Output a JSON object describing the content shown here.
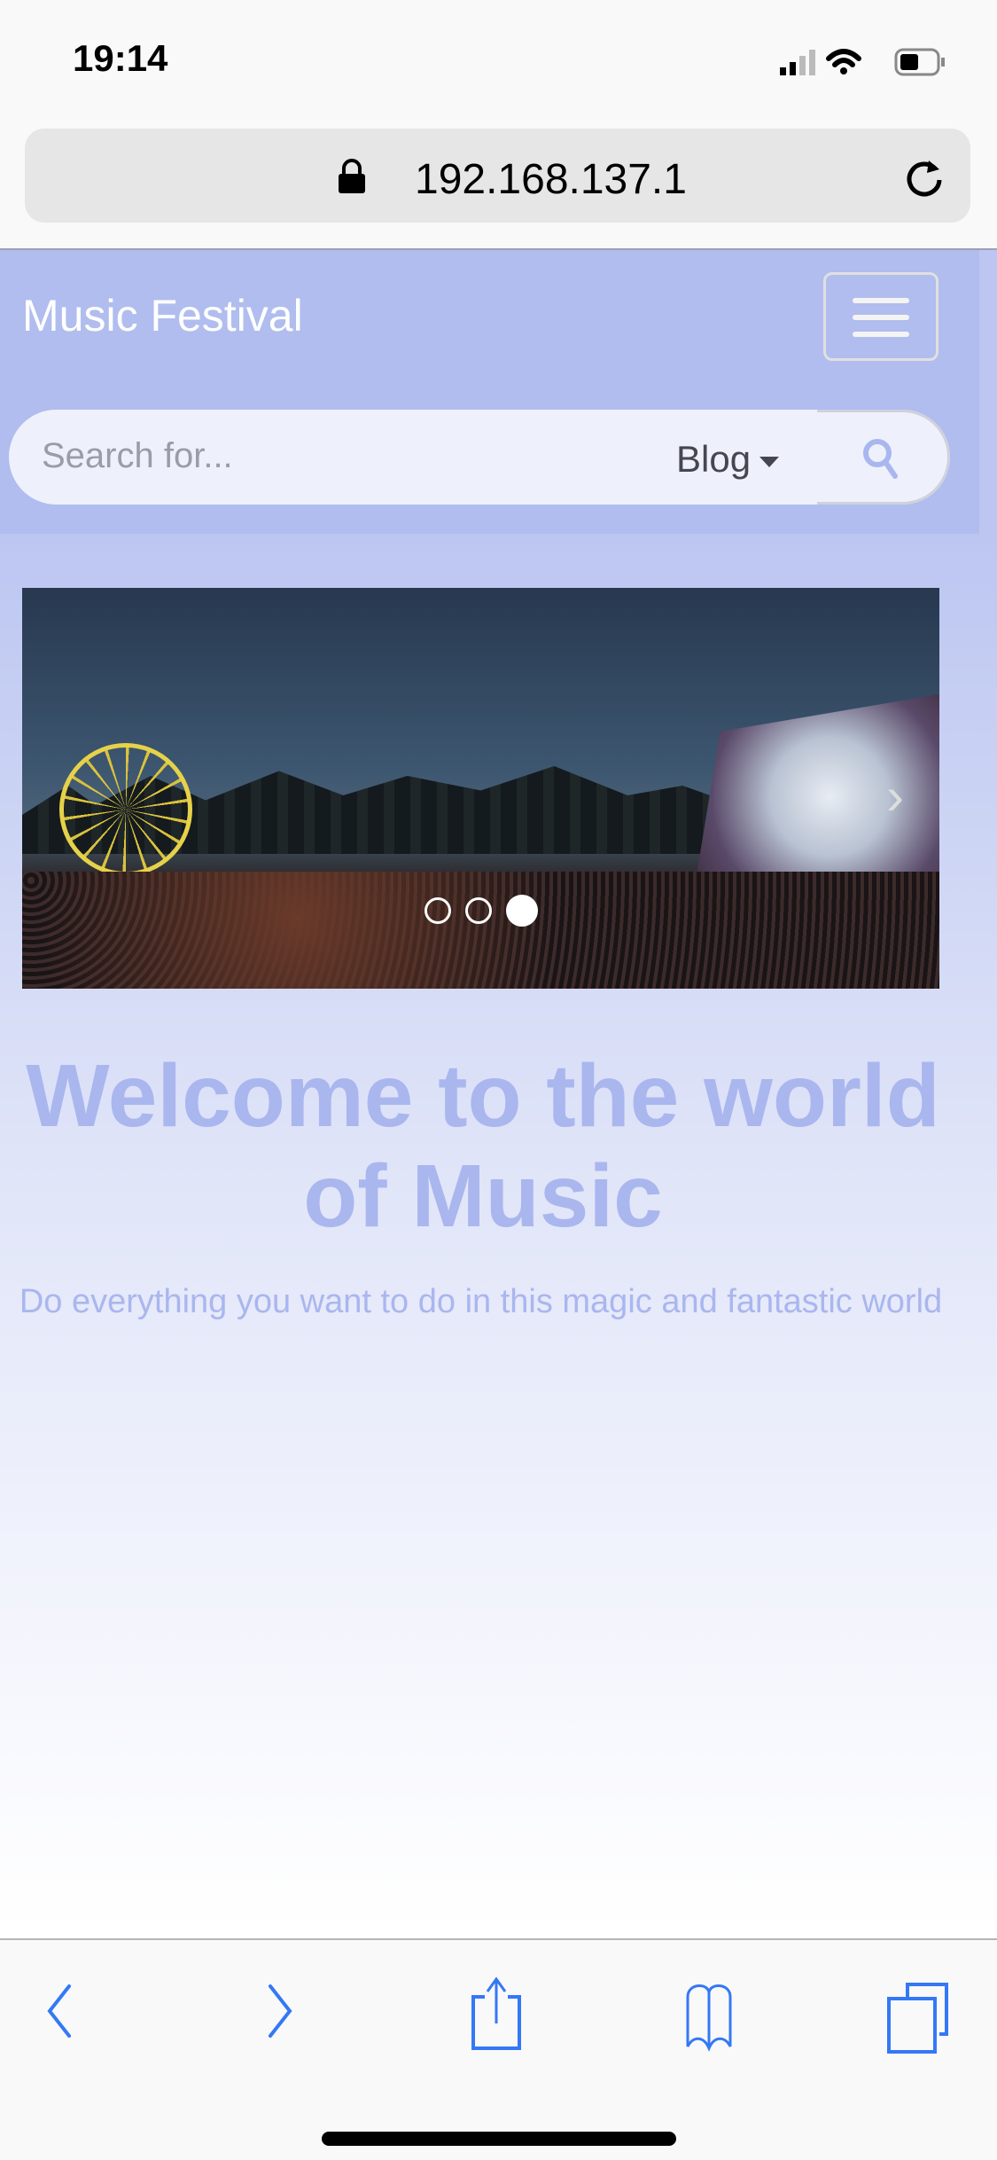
{
  "status_bar": {
    "time": "19:14",
    "icons": [
      "signal-icon",
      "wifi-icon",
      "battery-icon"
    ]
  },
  "browser": {
    "url": "192.168.137.1",
    "icons": [
      "lock-icon",
      "reload-icon"
    ]
  },
  "navbar": {
    "brand": "Music Festival",
    "menu_icon": "hamburger-icon"
  },
  "search": {
    "placeholder": "Search for...",
    "category": "Blog",
    "icon": "search-icon"
  },
  "carousel": {
    "slide_count": 3,
    "active_index": 2
  },
  "hero": {
    "title": "Welcome to the world of Music",
    "subtitle": "Do everything you want to do in this magic and fantastic world"
  },
  "toolbar": {
    "icons": [
      "back-icon",
      "forward-icon",
      "share-icon",
      "bookmarks-icon",
      "tabs-icon"
    ],
    "accent": "#3478f6"
  }
}
